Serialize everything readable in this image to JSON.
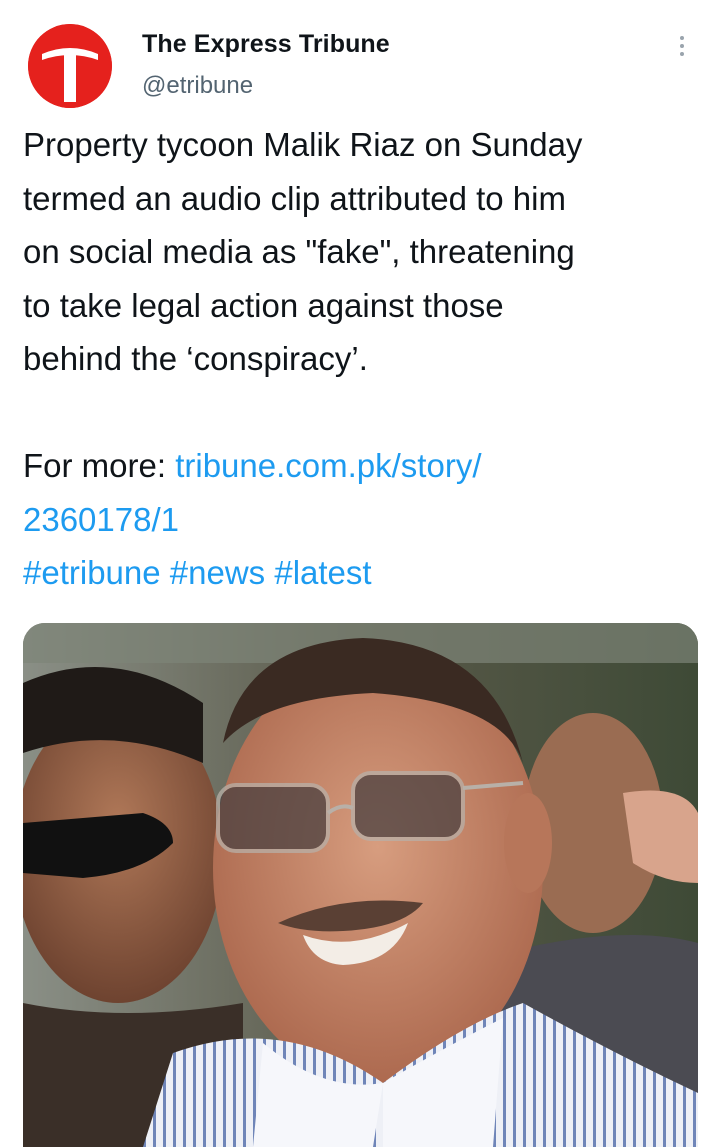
{
  "author": {
    "name": "The Express Tribune",
    "handle": "@etribune",
    "avatar_letter": "T",
    "avatar_color": "#e5211d"
  },
  "menu": {
    "icon": "more-vertical-icon"
  },
  "tweet": {
    "lines": [
      "Property tycoon Malik Riaz on Sunday",
      "termed an audio clip attributed to him",
      "on social media as \"fake\", threatening",
      "to take legal action against those",
      "behind the ‘conspiracy’."
    ],
    "more_prefix": "For more: ",
    "link_part1": "tribune.com.pk/story/",
    "link_part2": "2360178/1",
    "hashtags": [
      "#etribune",
      "#news",
      "#latest"
    ]
  },
  "colors": {
    "text": "#0f1419",
    "secondary": "#536471",
    "link": "#1d9bf0"
  }
}
